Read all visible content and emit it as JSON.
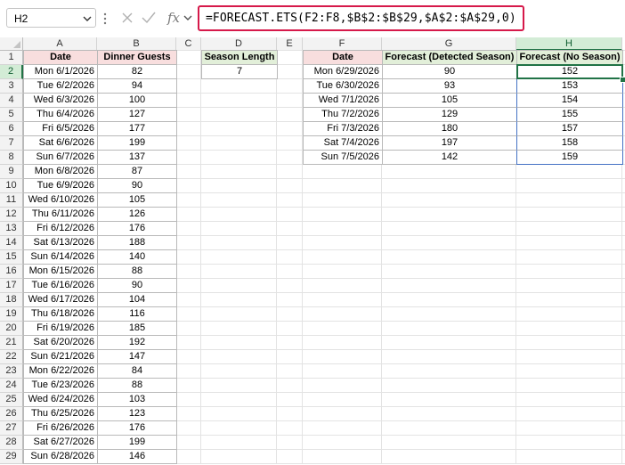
{
  "name_box": "H2",
  "formula": "=FORECAST.ETS(F2:F8,$B$2:$B$29,$A$2:$A$29,0)",
  "columns": [
    "A",
    "B",
    "C",
    "D",
    "E",
    "F",
    "G",
    "H"
  ],
  "selected_column": "H",
  "selected_row": 2,
  "rows": [
    "1",
    "2",
    "3",
    "4",
    "5",
    "6",
    "7",
    "8",
    "9",
    "10",
    "11",
    "12",
    "13",
    "14",
    "15",
    "16",
    "17",
    "18",
    "19",
    "20",
    "21",
    "22",
    "23",
    "24",
    "25",
    "26",
    "27",
    "28",
    "29"
  ],
  "table_a": {
    "headers": [
      "Date",
      "Dinner Guests"
    ],
    "dates": [
      "Mon 6/1/2026",
      "Tue 6/2/2026",
      "Wed 6/3/2026",
      "Thu 6/4/2026",
      "Fri 6/5/2026",
      "Sat 6/6/2026",
      "Sun 6/7/2026",
      "Mon 6/8/2026",
      "Tue 6/9/2026",
      "Wed 6/10/2026",
      "Thu 6/11/2026",
      "Fri 6/12/2026",
      "Sat 6/13/2026",
      "Sun 6/14/2026",
      "Mon 6/15/2026",
      "Tue 6/16/2026",
      "Wed 6/17/2026",
      "Thu 6/18/2026",
      "Fri 6/19/2026",
      "Sat 6/20/2026",
      "Sun 6/21/2026",
      "Mon 6/22/2026",
      "Tue 6/23/2026",
      "Wed 6/24/2026",
      "Thu 6/25/2026",
      "Fri 6/26/2026",
      "Sat 6/27/2026",
      "Sun 6/28/2026"
    ],
    "guests": [
      "82",
      "94",
      "100",
      "127",
      "177",
      "199",
      "137",
      "87",
      "90",
      "105",
      "126",
      "176",
      "188",
      "140",
      "88",
      "90",
      "104",
      "116",
      "185",
      "192",
      "147",
      "84",
      "88",
      "103",
      "123",
      "176",
      "199",
      "146"
    ]
  },
  "season": {
    "header": "Season Length",
    "value": "7"
  },
  "forecast": {
    "headers": [
      "Date",
      "Forecast (Detected Season)",
      "Forecast (No Season)"
    ],
    "dates": [
      "Mon 6/29/2026",
      "Tue 6/30/2026",
      "Wed 7/1/2026",
      "Thu 7/2/2026",
      "Fri 7/3/2026",
      "Sat 7/4/2026",
      "Sun 7/5/2026"
    ],
    "detected": [
      "90",
      "93",
      "105",
      "129",
      "180",
      "197",
      "142"
    ],
    "no_season": [
      "152",
      "153",
      "154",
      "155",
      "157",
      "158",
      "159"
    ]
  },
  "colors": {
    "accent_green": "#217346",
    "highlight_red": "#d6194a",
    "hdr_pink": "#f8dede",
    "hdr_green": "#e2efd9",
    "range_blue": "#4472c4"
  }
}
